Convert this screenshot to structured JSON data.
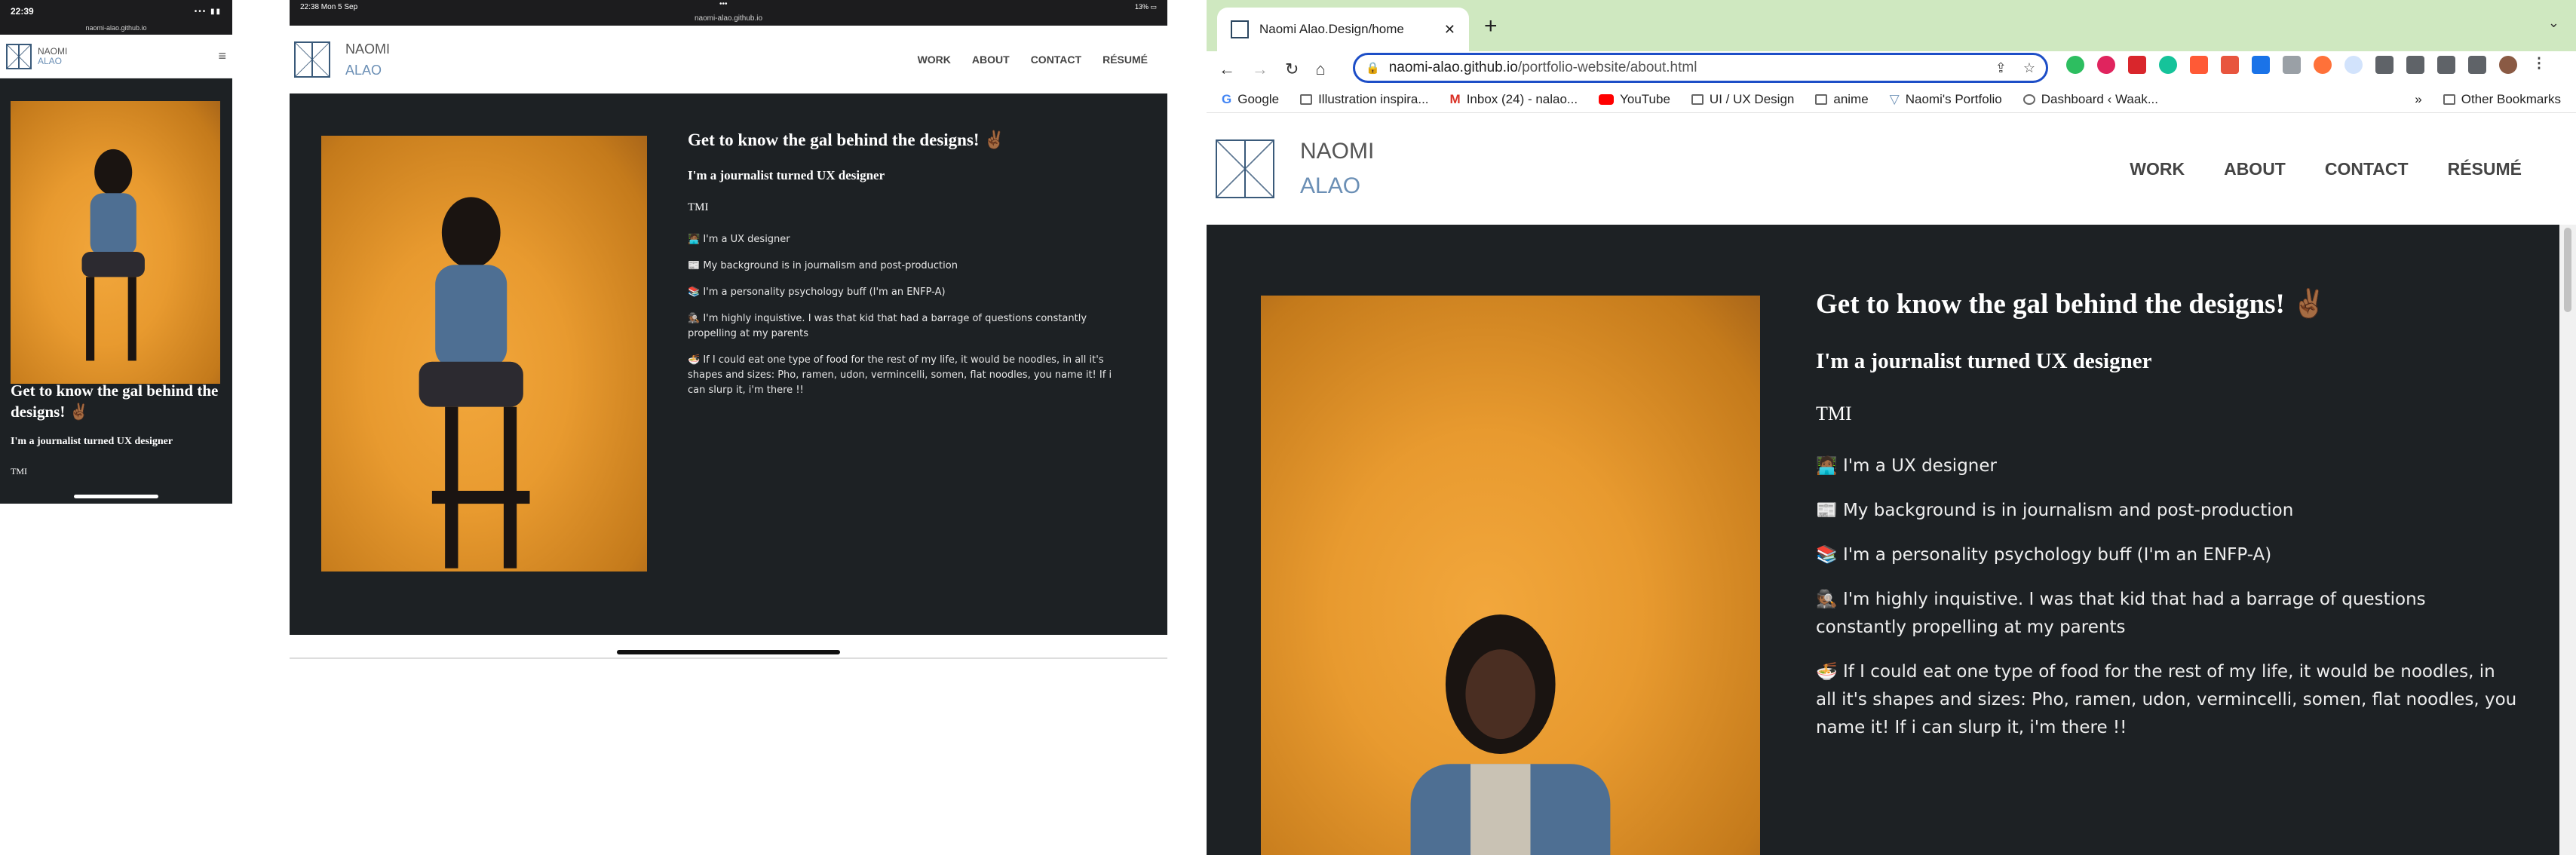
{
  "phone": {
    "status_time": "22:39",
    "status_icons": "•••  ▮▮",
    "url": "naomi-alao.github.io",
    "site_first": "NAOMI",
    "site_last": "ALAO",
    "heading": "Get to know the gal behind the designs! ✌🏾",
    "subheading": "I'm a journalist turned UX designer",
    "tmi": "TMI"
  },
  "tablet": {
    "status_time": "22:38  Mon 5 Sep",
    "status_right": "13% ▭",
    "url": "naomi-alao.github.io",
    "site_first": "NAOMI",
    "site_last": "ALAO",
    "nav": [
      "WORK",
      "ABOUT",
      "CONTACT",
      "RÉSUMÉ"
    ],
    "heading": "Get to know the gal behind the designs! ✌🏾",
    "subheading": "I'm a journalist turned UX designer",
    "tmi": "TMI",
    "facts": [
      "🧑🏾‍💻 I'm a UX designer",
      "📰 My background is in journalism and post-production",
      "📚 I'm a personality psychology buff (I'm an ENFP-A)",
      "🕵🏾 I'm highly inquistive. I was that kid that had a barrage of questions constantly propelling at my parents",
      "🍜 If I could eat one type of food for the rest of my life, it would be noodles, in all it's shapes and sizes: Pho, ramen, udon, vermincelli, somen, flat noodles, you name it! If i can slurp it, i'm there !!"
    ]
  },
  "browser": {
    "tab_title": "Naomi Alao.Design/home",
    "url_host": "naomi-alao.github.io",
    "url_path": "/portfolio-website/about.html",
    "bookmarks": [
      "Google",
      "Illustration inspira...",
      "Inbox (24) - nalao...",
      "YouTube",
      "UI / UX Design",
      "anime",
      "Naomi's Portfolio",
      "Dashboard ‹ Waak..."
    ],
    "more_bookmarks": "»",
    "other_bookmarks": "Other Bookmarks",
    "site_first": "NAOMI",
    "site_last": "ALAO",
    "nav": [
      "WORK",
      "ABOUT",
      "CONTACT",
      "RÉSUMÉ"
    ],
    "heading": "Get to know the gal behind the designs! ✌🏾",
    "subheading": "I'm a journalist turned UX designer",
    "tmi": "TMI",
    "facts": [
      "🧑🏾‍💻 I'm a UX designer",
      "📰 My background is in journalism and post-production",
      "📚 I'm a personality psychology buff (I'm an ENFP-A)",
      "🕵🏾 I'm highly inquistive. I was that kid that had a barrage of questions constantly propelling at my parents",
      "🍜 If I could eat one type of food for the rest of my life, it would be noodles, in all it's shapes and sizes: Pho, ramen, udon, vermincelli, somen, flat noodles, you name it! If i can slurp it, i'm there !!"
    ]
  },
  "colors": {
    "dark_bg": "#1d2124",
    "accent": "#6b8fb5",
    "photo_orange": "#e89a2f",
    "tab_green": "#cfe8c0"
  }
}
